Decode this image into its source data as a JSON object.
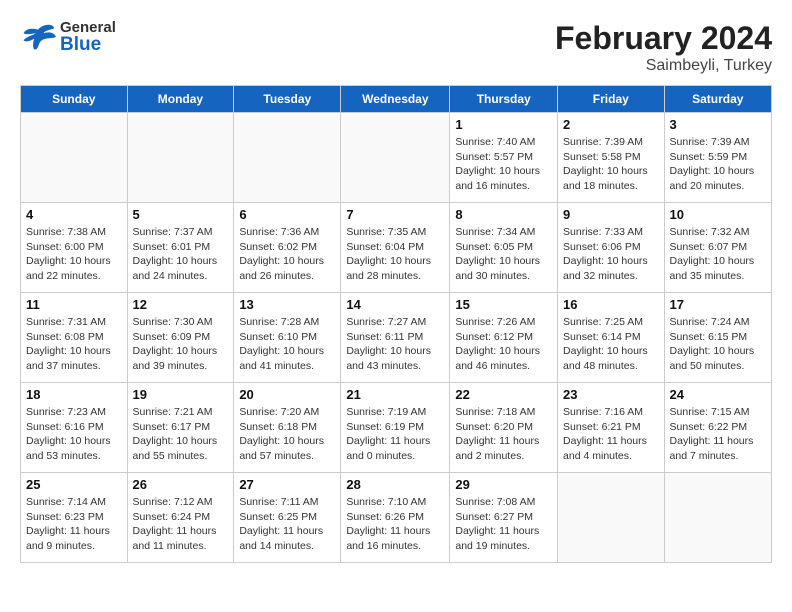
{
  "header": {
    "logo_general": "General",
    "logo_blue": "Blue",
    "month_year": "February 2024",
    "location": "Saimbeyli, Turkey"
  },
  "days_of_week": [
    "Sunday",
    "Monday",
    "Tuesday",
    "Wednesday",
    "Thursday",
    "Friday",
    "Saturday"
  ],
  "weeks": [
    [
      {
        "day": "",
        "info": ""
      },
      {
        "day": "",
        "info": ""
      },
      {
        "day": "",
        "info": ""
      },
      {
        "day": "",
        "info": ""
      },
      {
        "day": "1",
        "info": "Sunrise: 7:40 AM\nSunset: 5:57 PM\nDaylight: 10 hours\nand 16 minutes."
      },
      {
        "day": "2",
        "info": "Sunrise: 7:39 AM\nSunset: 5:58 PM\nDaylight: 10 hours\nand 18 minutes."
      },
      {
        "day": "3",
        "info": "Sunrise: 7:39 AM\nSunset: 5:59 PM\nDaylight: 10 hours\nand 20 minutes."
      }
    ],
    [
      {
        "day": "4",
        "info": "Sunrise: 7:38 AM\nSunset: 6:00 PM\nDaylight: 10 hours\nand 22 minutes."
      },
      {
        "day": "5",
        "info": "Sunrise: 7:37 AM\nSunset: 6:01 PM\nDaylight: 10 hours\nand 24 minutes."
      },
      {
        "day": "6",
        "info": "Sunrise: 7:36 AM\nSunset: 6:02 PM\nDaylight: 10 hours\nand 26 minutes."
      },
      {
        "day": "7",
        "info": "Sunrise: 7:35 AM\nSunset: 6:04 PM\nDaylight: 10 hours\nand 28 minutes."
      },
      {
        "day": "8",
        "info": "Sunrise: 7:34 AM\nSunset: 6:05 PM\nDaylight: 10 hours\nand 30 minutes."
      },
      {
        "day": "9",
        "info": "Sunrise: 7:33 AM\nSunset: 6:06 PM\nDaylight: 10 hours\nand 32 minutes."
      },
      {
        "day": "10",
        "info": "Sunrise: 7:32 AM\nSunset: 6:07 PM\nDaylight: 10 hours\nand 35 minutes."
      }
    ],
    [
      {
        "day": "11",
        "info": "Sunrise: 7:31 AM\nSunset: 6:08 PM\nDaylight: 10 hours\nand 37 minutes."
      },
      {
        "day": "12",
        "info": "Sunrise: 7:30 AM\nSunset: 6:09 PM\nDaylight: 10 hours\nand 39 minutes."
      },
      {
        "day": "13",
        "info": "Sunrise: 7:28 AM\nSunset: 6:10 PM\nDaylight: 10 hours\nand 41 minutes."
      },
      {
        "day": "14",
        "info": "Sunrise: 7:27 AM\nSunset: 6:11 PM\nDaylight: 10 hours\nand 43 minutes."
      },
      {
        "day": "15",
        "info": "Sunrise: 7:26 AM\nSunset: 6:12 PM\nDaylight: 10 hours\nand 46 minutes."
      },
      {
        "day": "16",
        "info": "Sunrise: 7:25 AM\nSunset: 6:14 PM\nDaylight: 10 hours\nand 48 minutes."
      },
      {
        "day": "17",
        "info": "Sunrise: 7:24 AM\nSunset: 6:15 PM\nDaylight: 10 hours\nand 50 minutes."
      }
    ],
    [
      {
        "day": "18",
        "info": "Sunrise: 7:23 AM\nSunset: 6:16 PM\nDaylight: 10 hours\nand 53 minutes."
      },
      {
        "day": "19",
        "info": "Sunrise: 7:21 AM\nSunset: 6:17 PM\nDaylight: 10 hours\nand 55 minutes."
      },
      {
        "day": "20",
        "info": "Sunrise: 7:20 AM\nSunset: 6:18 PM\nDaylight: 10 hours\nand 57 minutes."
      },
      {
        "day": "21",
        "info": "Sunrise: 7:19 AM\nSunset: 6:19 PM\nDaylight: 11 hours\nand 0 minutes."
      },
      {
        "day": "22",
        "info": "Sunrise: 7:18 AM\nSunset: 6:20 PM\nDaylight: 11 hours\nand 2 minutes."
      },
      {
        "day": "23",
        "info": "Sunrise: 7:16 AM\nSunset: 6:21 PM\nDaylight: 11 hours\nand 4 minutes."
      },
      {
        "day": "24",
        "info": "Sunrise: 7:15 AM\nSunset: 6:22 PM\nDaylight: 11 hours\nand 7 minutes."
      }
    ],
    [
      {
        "day": "25",
        "info": "Sunrise: 7:14 AM\nSunset: 6:23 PM\nDaylight: 11 hours\nand 9 minutes."
      },
      {
        "day": "26",
        "info": "Sunrise: 7:12 AM\nSunset: 6:24 PM\nDaylight: 11 hours\nand 11 minutes."
      },
      {
        "day": "27",
        "info": "Sunrise: 7:11 AM\nSunset: 6:25 PM\nDaylight: 11 hours\nand 14 minutes."
      },
      {
        "day": "28",
        "info": "Sunrise: 7:10 AM\nSunset: 6:26 PM\nDaylight: 11 hours\nand 16 minutes."
      },
      {
        "day": "29",
        "info": "Sunrise: 7:08 AM\nSunset: 6:27 PM\nDaylight: 11 hours\nand 19 minutes."
      },
      {
        "day": "",
        "info": ""
      },
      {
        "day": "",
        "info": ""
      }
    ]
  ]
}
